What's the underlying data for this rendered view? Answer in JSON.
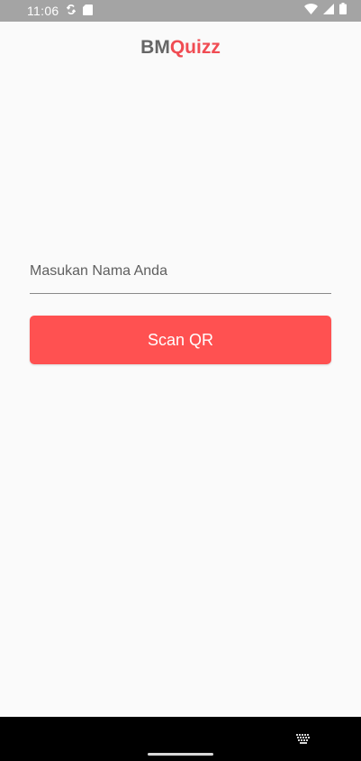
{
  "status_bar": {
    "time": "11:06",
    "icons": [
      "sync-icon",
      "sd-card-icon",
      "wifi-icon",
      "signal-icon",
      "battery-icon"
    ]
  },
  "app": {
    "title_prefix": "BM",
    "title_accent": "Quizz",
    "accent_color": "#f04c53"
  },
  "form": {
    "name_placeholder": "Masukan Nama Anda",
    "name_value": "",
    "scan_button_label": "Scan QR",
    "button_color": "#ff5151"
  },
  "nav_bar": {
    "icons": [
      "keyboard-icon",
      "home-indicator"
    ]
  }
}
